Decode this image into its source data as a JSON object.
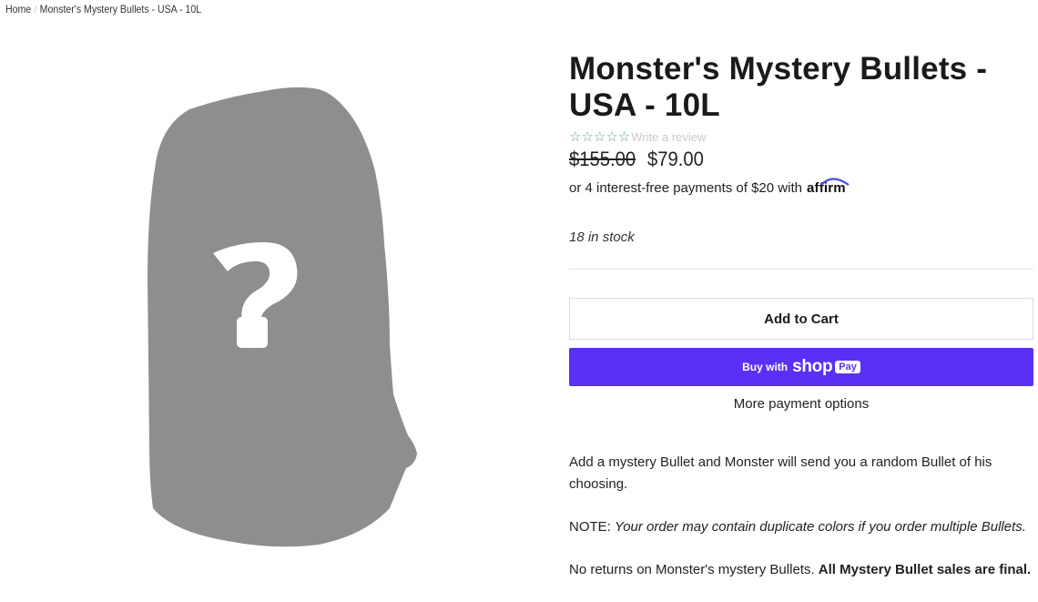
{
  "breadcrumb": {
    "home": "Home",
    "separator": "/",
    "current": "Monster's Mystery Bullets - USA - 10L"
  },
  "product": {
    "title": "Monster's Mystery Bullets - USA - 10L",
    "image_icon": "mystery-bag-question-icon",
    "rating": {
      "stars": 0,
      "max_stars": 5,
      "review_link": "Write a review"
    },
    "compare_price": "$155.00",
    "sale_price": "$79.00",
    "affirm": {
      "text": "or 4 interest-free payments of $20 with",
      "logo": "affirm"
    },
    "stock": "18 in stock",
    "add_to_cart": "Add to Cart",
    "shop_pay": {
      "buy_with": "Buy with",
      "shop": "shop",
      "pay": "Pay"
    },
    "more_payment_options": "More payment options",
    "description": {
      "p1": "Add a mystery Bullet and Monster will send you a random Bullet of his choosing.",
      "p2_label": "NOTE:",
      "p2_text": "Your order may contain duplicate colors if you order multiple Bullets.",
      "p3_text": "No returns on Monster's mystery Bullets.",
      "p3_bold": "All Mystery Bullet sales are final."
    }
  },
  "colors": {
    "shop_pay": "#5a31f4",
    "silhouette": "#8e8e8e",
    "star": "#6aa884"
  }
}
